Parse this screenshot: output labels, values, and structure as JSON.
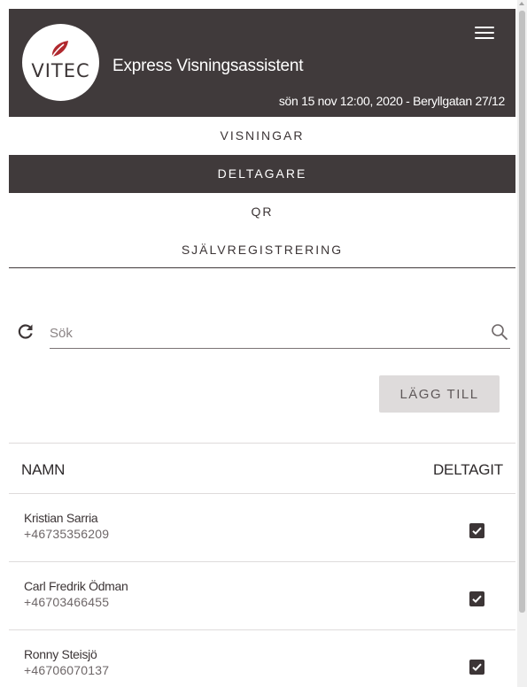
{
  "header": {
    "logo_text": "VITEC",
    "title": "Express Visningsassistent",
    "session_info": "sön 15 nov 12:00, 2020 - Beryllgatan 27/12",
    "menu_icon": "hamburger-menu-icon"
  },
  "nav": {
    "items": [
      {
        "label": "VISNINGAR",
        "active": false
      },
      {
        "label": "DELTAGARE",
        "active": true
      },
      {
        "label": "QR",
        "active": false
      },
      {
        "label": "SJÄLVREGISTRERING",
        "active": false
      }
    ]
  },
  "search": {
    "placeholder": "Sök",
    "value": "",
    "refresh_icon": "refresh-icon",
    "search_icon": "magnifier-icon"
  },
  "actions": {
    "add_label": "LÄGG TILL"
  },
  "table": {
    "columns": [
      "NAMN",
      "DELTAGIT"
    ],
    "rows": [
      {
        "name": "Kristian Sarria",
        "phone": "+46735356209",
        "attended": true
      },
      {
        "name": "Carl Fredrik Ödman",
        "phone": "+46703466455",
        "attended": true
      },
      {
        "name": "Ronny Steisjö",
        "phone": "+46706070137",
        "attended": true
      }
    ]
  },
  "colors": {
    "header_bg": "#403a3b",
    "logo_red": "#b0282e",
    "button_bg": "#dedbdb"
  }
}
